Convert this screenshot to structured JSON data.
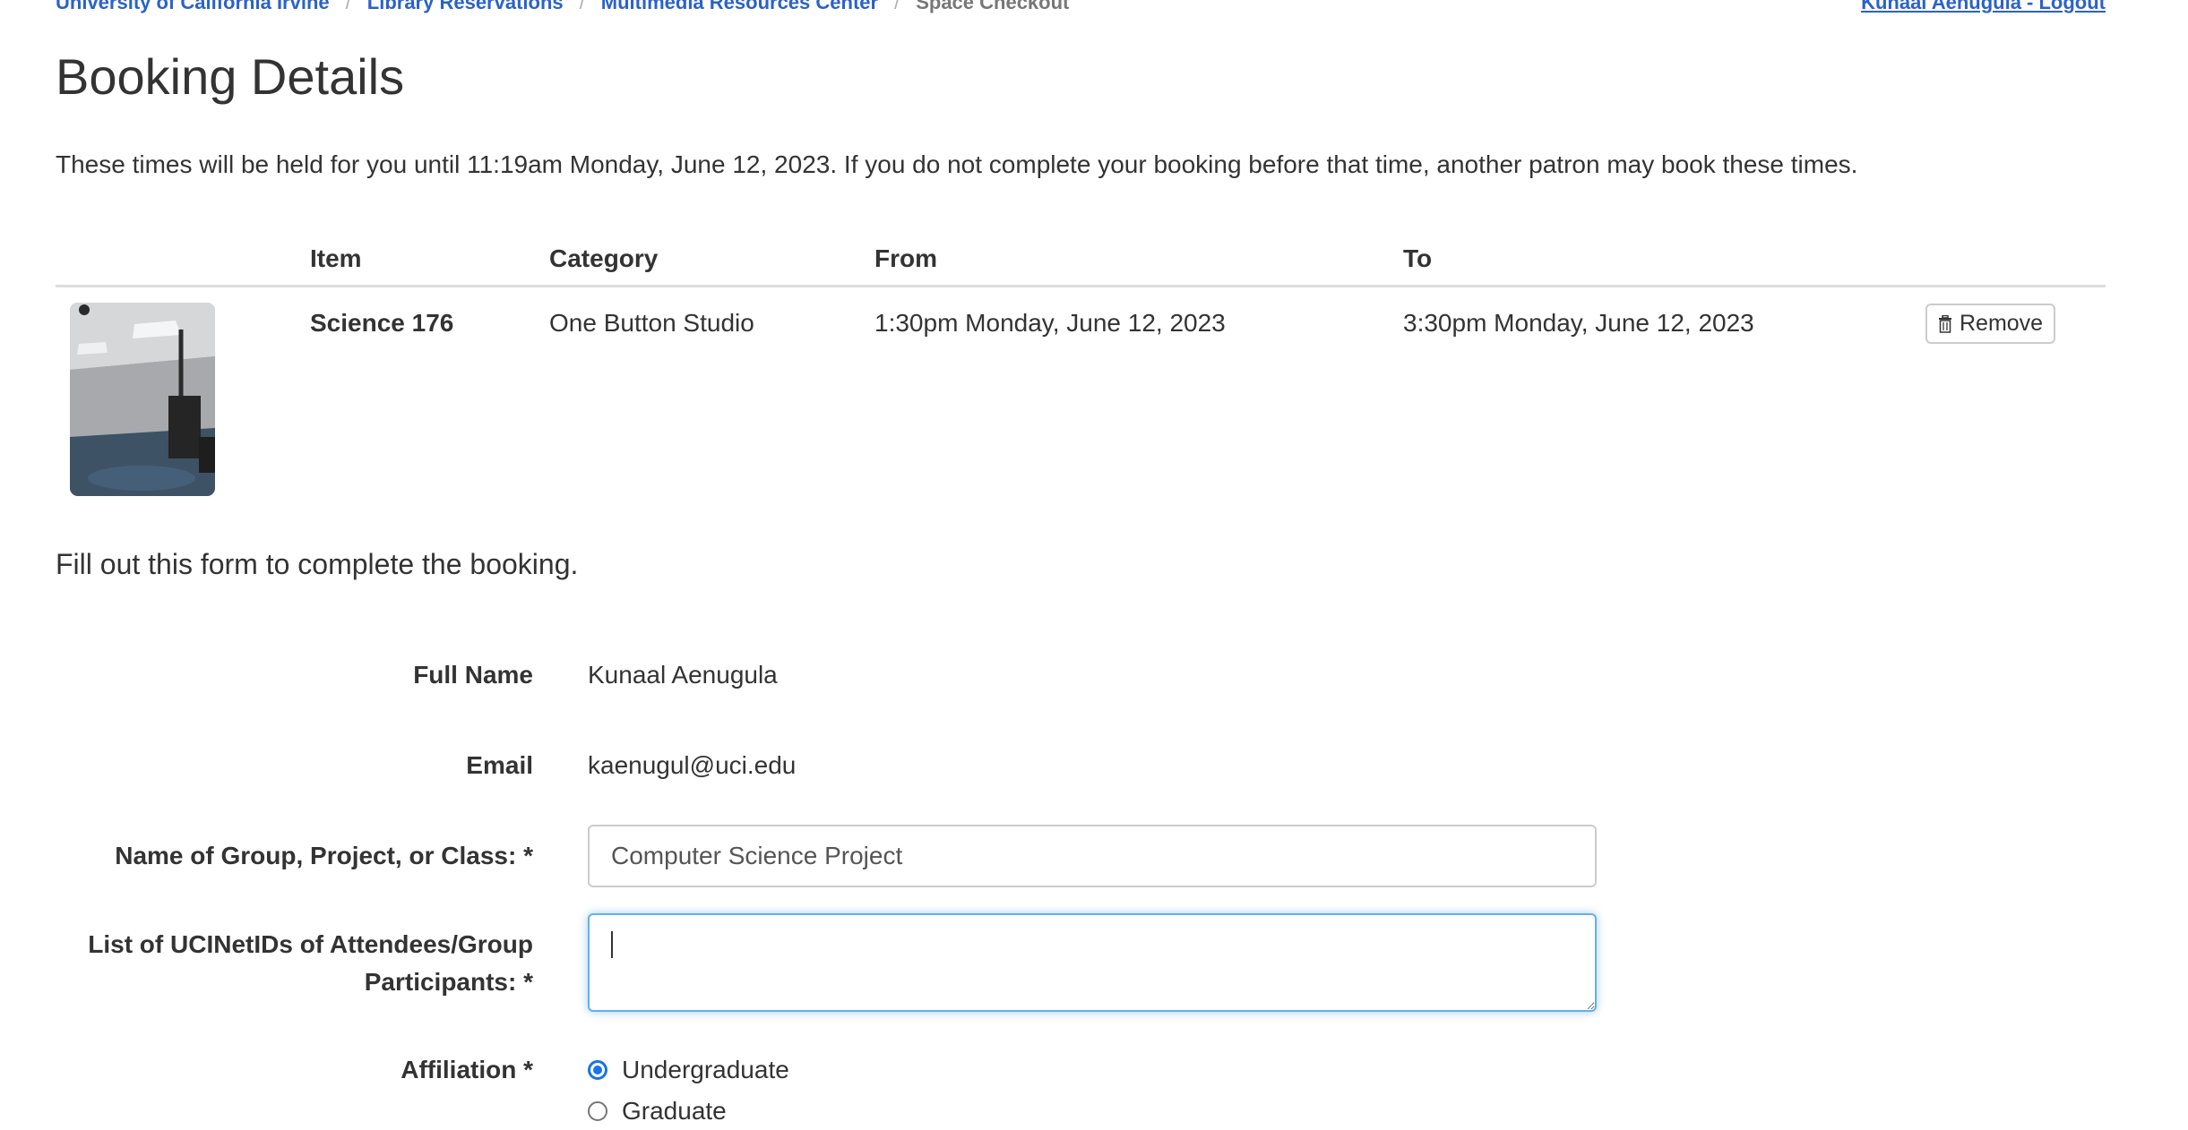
{
  "breadcrumb": {
    "items": [
      {
        "label": "University of California Irvine"
      },
      {
        "label": "Library Reservations"
      },
      {
        "label": "Multimedia Resources Center"
      }
    ],
    "separator": "/",
    "current": "Space Checkout"
  },
  "user_link": "Kunaal Aenugula - Logout",
  "page_title": "Booking Details",
  "hold_notice": "These times will be held for you until 11:19am Monday, June 12, 2023. If you do not complete your booking before that time, another patron may book these times.",
  "table": {
    "headers": {
      "item": "Item",
      "category": "Category",
      "from": "From",
      "to": "To"
    },
    "rows": [
      {
        "item": "Science 176",
        "category": "One Button Studio",
        "from": "1:30pm Monday, June 12, 2023",
        "to": "3:30pm Monday, June 12, 2023",
        "remove_label": "Remove",
        "remove_icon": "trash-icon"
      }
    ]
  },
  "form": {
    "intro": "Fill out this form to complete the booking.",
    "full_name": {
      "label": "Full Name",
      "value": "Kunaal Aenugula"
    },
    "email": {
      "label": "Email",
      "value": "kaenugul@uci.edu"
    },
    "group_name": {
      "label": "Name of Group, Project, or Class: *",
      "value": "Computer Science Project"
    },
    "attendees": {
      "label_line1": "List of UCINetIDs of Attendees/Group",
      "label_line2": "Participants: *",
      "value": ""
    },
    "affiliation": {
      "label": "Affiliation *",
      "options": [
        {
          "label": "Undergraduate",
          "selected": true
        },
        {
          "label": "Graduate",
          "selected": false
        }
      ]
    }
  },
  "colors": {
    "link": "#2a62c9",
    "focus_border": "#66afe9",
    "radio_accent": "#1a73e8"
  }
}
